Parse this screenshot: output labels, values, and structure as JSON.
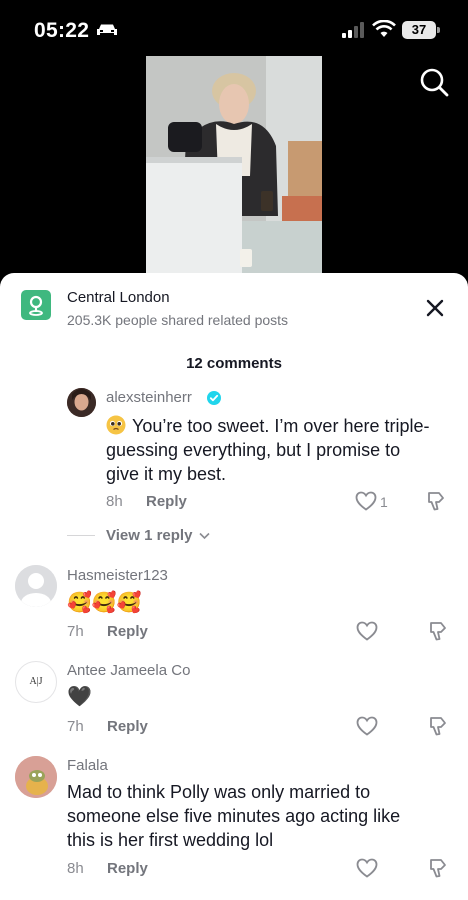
{
  "status_bar": {
    "time": "05:22",
    "battery": "37"
  },
  "location": {
    "title": "Central London",
    "subtitle": "205.3K people shared related posts"
  },
  "comments_header": "12 comments",
  "comments": [
    {
      "username": "alexsteinherr",
      "verified": true,
      "text_line1": "You’re too sweet. I’m over here triple-",
      "text_line2": "guessing everything, but I promise to",
      "text_line3": "give it my best.",
      "time": "8h",
      "reply_label": "Reply",
      "likes": "1",
      "view_replies": "View 1 reply"
    },
    {
      "username": "Hasmeister123",
      "text": "🥰🥰🥰",
      "time": "7h",
      "reply_label": "Reply"
    },
    {
      "username": "Antee Jameela Co",
      "avatar_text": "A|J",
      "text": "🖤",
      "time": "7h",
      "reply_label": "Reply"
    },
    {
      "username": "Falala",
      "text_line1": "Mad to think Polly was only married to",
      "text_line2": "someone else five minutes ago acting like",
      "text_line3": "this is her first wedding lol",
      "time": "8h",
      "reply_label": "Reply"
    }
  ],
  "colors": {
    "location_icon": "#3fb87f",
    "verified_badge": "#20d5ec",
    "text_primary": "#161823",
    "text_secondary": "#73757c"
  },
  "icons": [
    "car-icon",
    "signal-icon",
    "wifi-icon",
    "battery-icon",
    "search-icon",
    "location-pin-icon",
    "close-icon",
    "verified-icon",
    "heart-icon",
    "dislike-icon",
    "chevron-down-icon"
  ]
}
